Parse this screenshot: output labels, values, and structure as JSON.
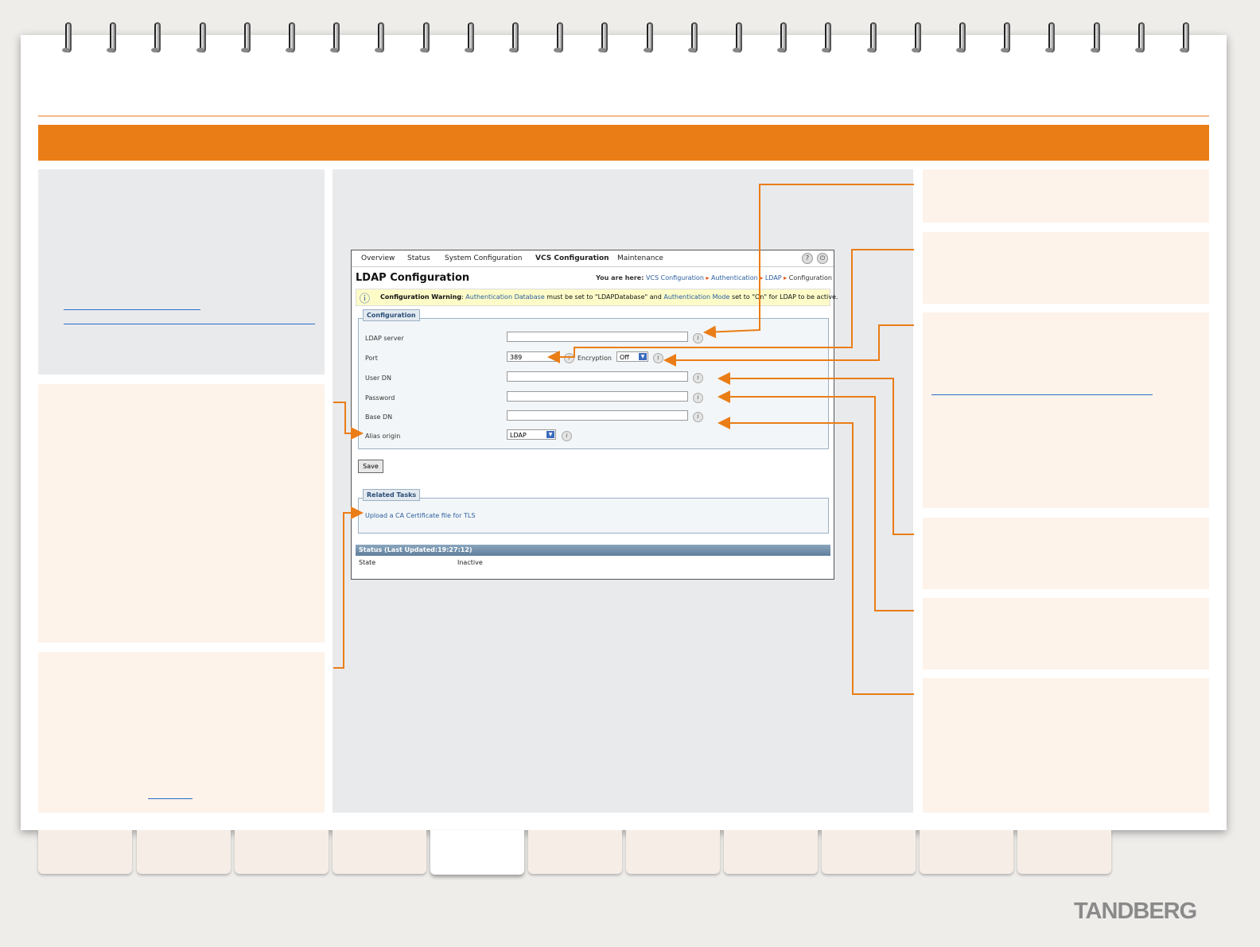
{
  "window": {
    "menu": [
      "Overview",
      "Status",
      "System Configuration",
      "VCS Configuration",
      "Maintenance"
    ],
    "title": "LDAP Configuration",
    "breadcrumb": {
      "prefix": "You are here:",
      "items": [
        "VCS Configuration",
        "Authentication",
        "LDAP",
        "Configuration"
      ]
    },
    "warning": {
      "label": "Configuration Warning",
      "link1": "Authentication Database",
      "text1": "must be set to \"LDAPDatabase\" and",
      "link2": "Authentication Mode",
      "text2": "set to \"On\" for LDAP to be active."
    },
    "configuration": {
      "legend": "Configuration",
      "ldap_server_label": "LDAP server",
      "port_label": "Port",
      "port_value": "389",
      "encryption_label": "Encryption",
      "encryption_value": "Off",
      "user_dn_label": "User DN",
      "password_label": "Password",
      "base_dn_label": "Base DN",
      "alias_origin_label": "Alias origin",
      "alias_origin_value": "LDAP"
    },
    "save_label": "Save",
    "related": {
      "legend": "Related Tasks",
      "link": "Upload a CA Certificate file for TLS"
    },
    "status": {
      "header": "Status (Last Updated:19:27:12)",
      "state_label": "State",
      "state_value": "Inactive"
    }
  },
  "logo": "TANDBERG",
  "colors": {
    "accent": "#ea7d16",
    "link": "#2a5e9e"
  }
}
